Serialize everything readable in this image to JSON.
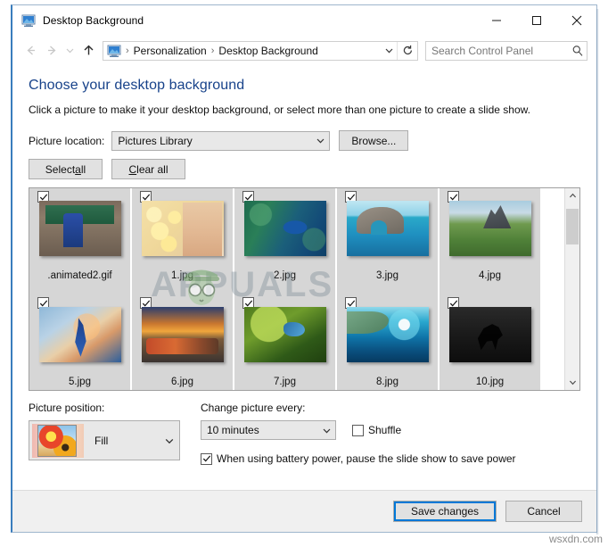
{
  "window": {
    "title": "Desktop Background",
    "icon": "desktop-background-icon",
    "controls": {
      "minimize": "minimize-icon",
      "maximize": "maximize-icon",
      "close": "close-icon"
    }
  },
  "navbar": {
    "back": "back-arrow-icon",
    "forward": "forward-arrow-icon",
    "recent": "recent-locations-icon",
    "up": "up-arrow-icon",
    "breadcrumb": [
      "Personalization",
      "Desktop Background"
    ],
    "separator": "›",
    "dropdown": "chevron-down-icon",
    "refresh": "refresh-icon",
    "search": {
      "placeholder": "Search Control Panel",
      "value": "",
      "icon": "search-icon"
    }
  },
  "content": {
    "heading": "Choose your desktop background",
    "subtext": "Click a picture to make it your desktop background, or select more than one picture to create a slide show.",
    "picture_location": {
      "label": "Picture location:",
      "value": "Pictures Library"
    },
    "browse_button": "Browse...",
    "select_all_button": {
      "pre": "Select ",
      "accel": "a",
      "post": "ll"
    },
    "clear_all_button": {
      "pre": "",
      "accel": "C",
      "post": "lear all"
    }
  },
  "grid": {
    "rows": [
      [
        {
          "name": ".animated2.gif",
          "checked": true,
          "art": "art-animated"
        },
        {
          "name": "1.jpg",
          "checked": true,
          "art": "art-1"
        },
        {
          "name": "2.jpg",
          "checked": true,
          "art": "art-2"
        },
        {
          "name": "3.jpg",
          "checked": true,
          "art": "art-3"
        },
        {
          "name": "4.jpg",
          "checked": true,
          "art": "art-4"
        }
      ],
      [
        {
          "name": "5.jpg",
          "checked": true,
          "art": "art-5"
        },
        {
          "name": "6.jpg",
          "checked": true,
          "art": "art-6"
        },
        {
          "name": "7.jpg",
          "checked": true,
          "art": "art-7"
        },
        {
          "name": "8.jpg",
          "checked": true,
          "art": "art-8"
        },
        {
          "name": "10.jpg",
          "checked": true,
          "art": "art-10"
        }
      ],
      [
        {
          "name": "",
          "checked": true,
          "art": "art-dark-strip"
        },
        {
          "name": "",
          "checked": true,
          "art": "art-blue-strip"
        },
        {
          "name": "",
          "checked": true,
          "art": "art-gray-strip"
        },
        {
          "name": "",
          "checked": true,
          "art": "art-dark-strip"
        },
        {
          "name": "",
          "checked": true,
          "art": "art-dark-strip"
        }
      ]
    ],
    "scrollbar": {
      "up": "scroll-up-icon",
      "down": "scroll-down-icon"
    }
  },
  "options": {
    "picture_position": {
      "label": "Picture position:",
      "value": "Fill"
    },
    "change_picture_every": {
      "label": "Change picture every:",
      "value": "10 minutes"
    },
    "shuffle": {
      "label": "Shuffle",
      "checked": false
    },
    "battery": {
      "label": "When using battery power, pause the slide show to save power",
      "checked": true
    }
  },
  "footer": {
    "save_label": "Save changes",
    "cancel_label": "Cancel"
  },
  "watermarks": {
    "appuals": "APPUALS",
    "wsxdn": "wsxdn.com"
  },
  "colors": {
    "heading": "#17428a",
    "accent": "#0078d7",
    "window_border": "#3a7dbd",
    "cell_bg": "#d6d6d6"
  }
}
